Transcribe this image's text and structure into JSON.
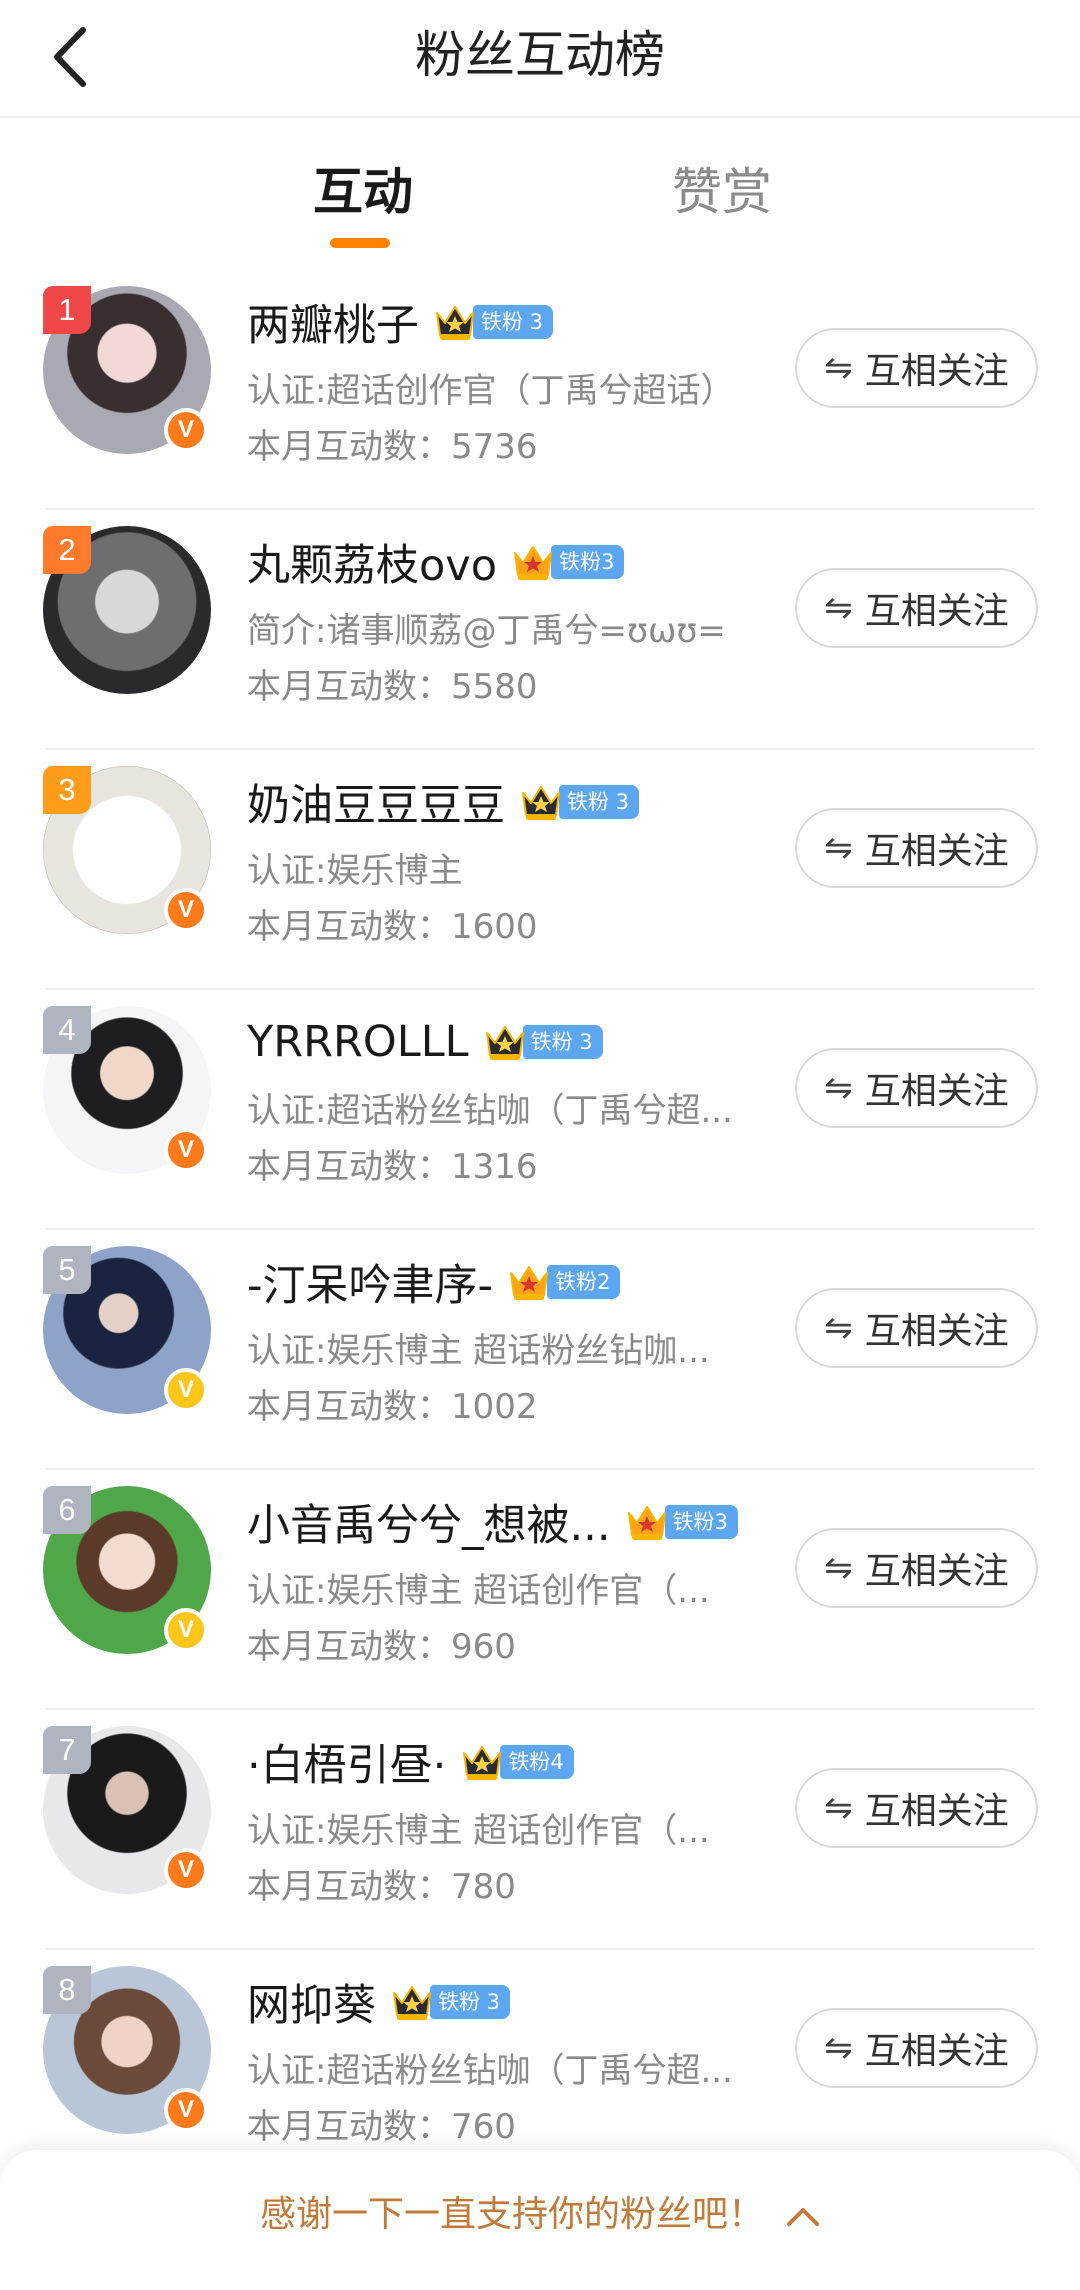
{
  "header": {
    "title": "粉丝互动榜"
  },
  "tabs": [
    {
      "label": "互动",
      "active": true
    },
    {
      "label": "赞赏",
      "active": false
    }
  ],
  "colors": {
    "accent": "#ff8200",
    "fan_badge": "#5ca6f2",
    "footer_text": "#c07a3a"
  },
  "rank_colors": [
    "#f04848",
    "#ff7a2a",
    "#ff9d1a",
    "#b0b4c0",
    "#b0b4c0",
    "#b0b4c0",
    "#b0b4c0",
    "#b0b4c0"
  ],
  "fans": [
    {
      "rank": "1",
      "name": "两瓣桃子",
      "crown": "dark",
      "fan_badge": "铁粉 3",
      "desc": "认证:超话创作官（丁禹兮超话）",
      "count": "本月互动数：5736",
      "verified": "orange",
      "button": "互相关注"
    },
    {
      "rank": "2",
      "name": "丸颗荔枝ovo",
      "crown": "orange",
      "fan_badge": "铁粉3",
      "desc": "简介:诸事顺荔@丁禹兮=ʊωʊ=",
      "count": "本月互动数：5580",
      "verified": "",
      "button": "互相关注"
    },
    {
      "rank": "3",
      "name": "奶油豆豆豆豆",
      "crown": "dark",
      "fan_badge": "铁粉 3",
      "desc": "认证:娱乐博主",
      "count": "本月互动数：1600",
      "verified": "orange",
      "button": "互相关注"
    },
    {
      "rank": "4",
      "name": "YRRROLLL",
      "crown": "dark",
      "fan_badge": "铁粉 3",
      "desc": "认证:超话粉丝钻咖（丁禹兮超...",
      "count": "本月互动数：1316",
      "verified": "orange",
      "button": "互相关注"
    },
    {
      "rank": "5",
      "name": "-汀呆吟聿序-",
      "crown": "orange",
      "fan_badge": "铁粉2",
      "desc": "认证:娱乐博主 超话粉丝钻咖...",
      "count": "本月互动数：1002",
      "verified": "yellow",
      "button": "互相关注"
    },
    {
      "rank": "6",
      "name": "小音禹兮兮_想被...",
      "crown": "orange",
      "fan_badge": "铁粉3",
      "desc": "认证:娱乐博主 超话创作官（...",
      "count": "本月互动数：960",
      "verified": "yellow",
      "button": "互相关注"
    },
    {
      "rank": "7",
      "name": "·白梧引昼·",
      "crown": "dark",
      "fan_badge": "铁粉4",
      "desc": "认证:娱乐博主 超话创作官（...",
      "count": "本月互动数：780",
      "verified": "orange",
      "button": "互相关注"
    },
    {
      "rank": "8",
      "name": "网抑葵",
      "crown": "dark",
      "fan_badge": "铁粉 3",
      "desc": "认证:超话粉丝钻咖（丁禹兮超...",
      "count": "本月互动数：760",
      "verified": "orange",
      "button": "互相关注"
    }
  ],
  "footer": {
    "text": "感谢一下一直支持你的粉丝吧！"
  }
}
